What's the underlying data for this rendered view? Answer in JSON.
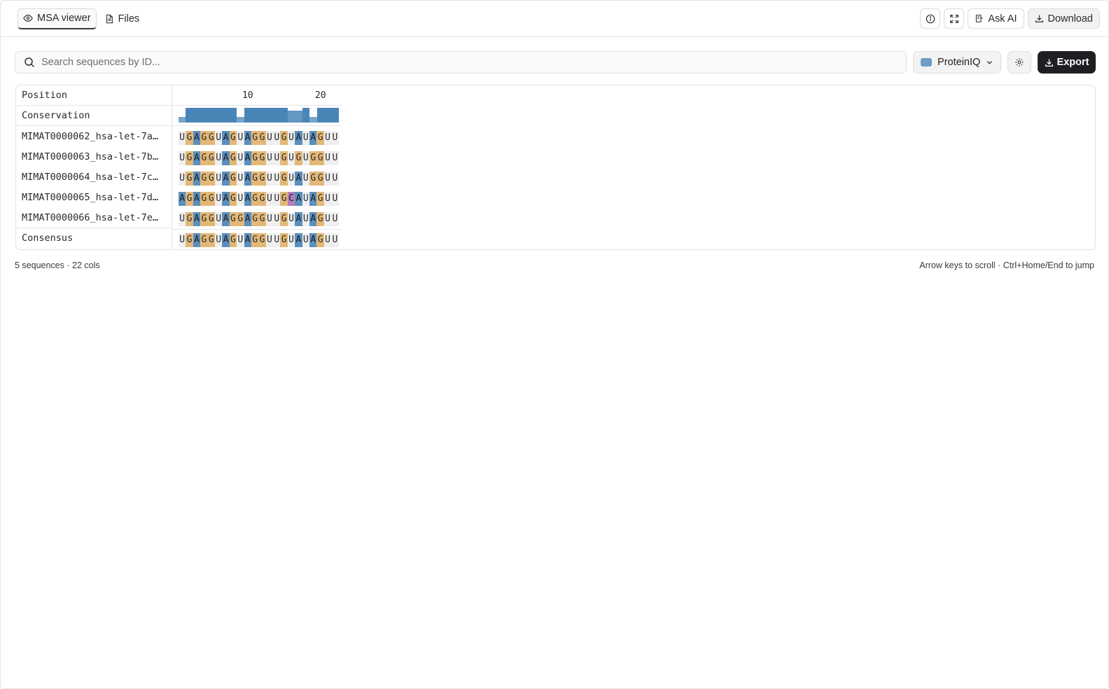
{
  "tabs": [
    {
      "label": "MSA viewer",
      "active": true,
      "icon": "eye-icon"
    },
    {
      "label": "Files",
      "active": false,
      "icon": "file-icon"
    }
  ],
  "header_actions": {
    "info_icon": "info-icon",
    "fullscreen_icon": "expand-icon",
    "ask_ai_label": "Ask AI",
    "download_label": "Download"
  },
  "toolbar": {
    "search_placeholder": "Search sequences by ID...",
    "search_value": "",
    "color_scheme": "ProteinIQ",
    "color_scheme_swatch": "#6f9cc4",
    "export_label": "Export"
  },
  "alignment": {
    "position_label": "Position",
    "conservation_label": "Conservation",
    "consensus_label": "Consensus",
    "position_ticks": [
      10,
      20
    ],
    "conservation": [
      0.4,
      1,
      1,
      1,
      1,
      1,
      1,
      1,
      0.4,
      1,
      1,
      1,
      1,
      1,
      1,
      0.8,
      0.8,
      1,
      0.4,
      1,
      1,
      1
    ],
    "sequences": [
      {
        "id": "MIMAT0000062_hsa-let-7a…",
        "residues": "UGAGGUAGUAGGUUGUAUAGUU"
      },
      {
        "id": "MIMAT0000063_hsa-let-7b…",
        "residues": "UGAGGUAGUAGGUUGUGUGGUU"
      },
      {
        "id": "MIMAT0000064_hsa-let-7c…",
        "residues": "UGAGGUAGUAGGUUGUAUGGUU"
      },
      {
        "id": "MIMAT0000065_hsa-let-7d…",
        "residues": "AGAGGUAGUAGGUUGCAUAGUU"
      },
      {
        "id": "MIMAT0000066_hsa-let-7e…",
        "residues": "UGAGGUAGGAGGUUGUAUAGUU"
      }
    ],
    "consensus": "UGAGGUAGUAGGUUGUAUAGUU"
  },
  "residue_colors": {
    "A": "#5b8fbf",
    "G": "#e3b877",
    "U": "#efefef",
    "C": "#b37fbd"
  },
  "conservation_color": "#4a85b8",
  "footer": {
    "summary": "5 sequences · 22 cols",
    "hint": "Arrow keys to scroll · Ctrl+Home/End to jump"
  }
}
